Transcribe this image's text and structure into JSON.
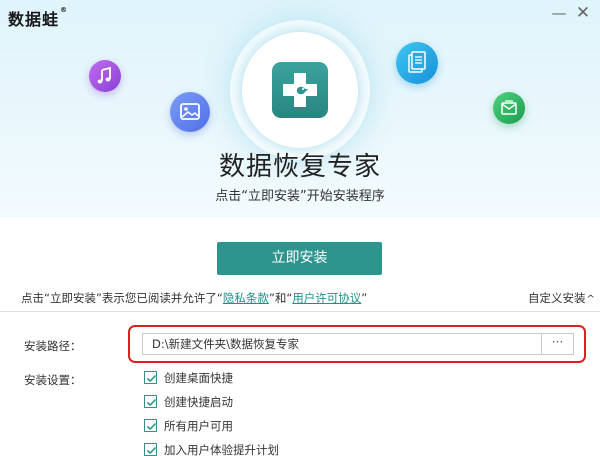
{
  "window": {
    "logo_text": "数据蛙",
    "logo_tm": "®",
    "minimize_glyph": "—",
    "close_glyph": "✕"
  },
  "hero": {
    "title": "数据恢复专家",
    "subtitle": "点击“立即安装”开始安装程序",
    "icons": [
      "music-icon",
      "image-icon",
      "document-icon",
      "mail-icon",
      "medical-cross-app-icon"
    ]
  },
  "install": {
    "button_label": "立即安装",
    "agreement_prefix": "点击“立即安装”表示您已阅读并允许了“",
    "privacy_link": "隐私条款",
    "agreement_middle": "”和“",
    "license_link": "用户许可协议",
    "agreement_suffix": "”",
    "custom_label": "自定义安装",
    "custom_chevron": "^"
  },
  "settings": {
    "path_label": "安装路径：",
    "path_value": "D:\\新建文件夹\\数据恢复专家",
    "browse_label": "···",
    "settings_label": "安装设置：",
    "options": [
      {
        "label": "创建桌面快捷",
        "checked": true
      },
      {
        "label": "创建快捷启动",
        "checked": true
      },
      {
        "label": "所有用户可用",
        "checked": true
      },
      {
        "label": "加入用户体验提升计划",
        "checked": true
      }
    ]
  },
  "colors": {
    "accent": "#2e948e",
    "highlight": "#e02020",
    "hero_bg": "#e4f5fb"
  }
}
